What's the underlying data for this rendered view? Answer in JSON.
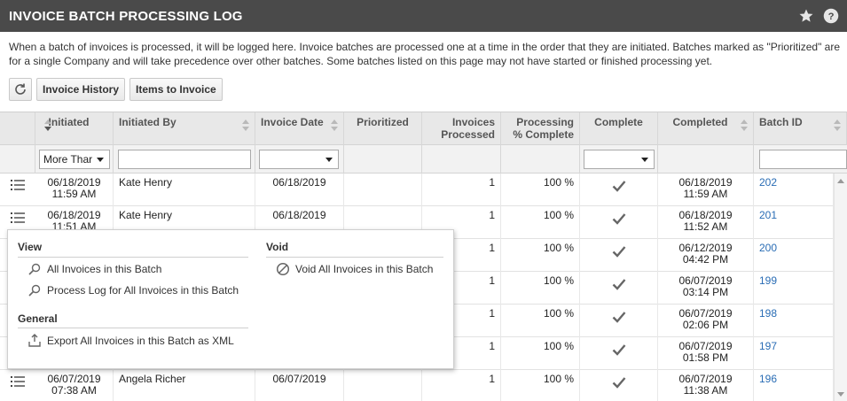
{
  "header": {
    "title": "INVOICE BATCH PROCESSING LOG",
    "star_icon": "star-icon",
    "help_icon": "help-icon"
  },
  "description": "When a batch of invoices is processed, it will be logged here. Invoice batches are processed one at a time in the order that they are initiated. Batches marked as \"Prioritized\" are for a single Company and will take precedence over other batches. Some batches listed on this page may not have started or finished processing yet.",
  "toolbar": {
    "refresh_icon": "refresh-icon",
    "invoice_history": "Invoice History",
    "items_to_invoice": "Items to Invoice"
  },
  "columns": {
    "initiated": "Initiated",
    "initiated_by": "Initiated By",
    "invoice_date": "Invoice Date",
    "prioritized": "Prioritized",
    "invoices_processed": "Invoices Processed",
    "processing_pct": "Processing % Complete",
    "complete": "Complete",
    "completed": "Completed",
    "batch_id": "Batch ID"
  },
  "filters": {
    "initiated_value": "More Thar",
    "invoice_date_value": "",
    "complete_value": "",
    "initiated_by_value": "",
    "batch_id_value": ""
  },
  "rows": [
    {
      "initiated": "06/18/2019\n11:59 AM",
      "initiated_by": "Kate Henry",
      "invoice_date": "06/18/2019",
      "prioritized": "",
      "invoices_processed": "1",
      "processing_pct": "100 %",
      "complete": true,
      "completed": "06/18/2019\n11:59 AM",
      "batch_id": "202"
    },
    {
      "initiated": "06/18/2019\n11:51 AM",
      "initiated_by": "Kate Henry",
      "invoice_date": "06/18/2019",
      "prioritized": "",
      "invoices_processed": "1",
      "processing_pct": "100 %",
      "complete": true,
      "completed": "06/18/2019\n11:52 AM",
      "batch_id": "201"
    },
    {
      "initiated": "",
      "initiated_by": "",
      "invoice_date": "",
      "prioritized": "",
      "invoices_processed": "1",
      "processing_pct": "100 %",
      "complete": true,
      "completed": "06/12/2019\n04:42 PM",
      "batch_id": "200"
    },
    {
      "initiated": "",
      "initiated_by": "",
      "invoice_date": "",
      "prioritized": "",
      "invoices_processed": "1",
      "processing_pct": "100 %",
      "complete": true,
      "completed": "06/07/2019\n03:14 PM",
      "batch_id": "199"
    },
    {
      "initiated": "",
      "initiated_by": "",
      "invoice_date": "",
      "prioritized": "",
      "invoices_processed": "1",
      "processing_pct": "100 %",
      "complete": true,
      "completed": "06/07/2019\n02:06 PM",
      "batch_id": "198"
    },
    {
      "initiated": "",
      "initiated_by": "",
      "invoice_date": "",
      "prioritized": "",
      "invoices_processed": "1",
      "processing_pct": "100 %",
      "complete": true,
      "completed": "06/07/2019\n01:58 PM",
      "batch_id": "197"
    },
    {
      "initiated": "06/07/2019\n07:38 AM",
      "initiated_by": "Angela Richer",
      "invoice_date": "06/07/2019",
      "prioritized": "",
      "invoices_processed": "1",
      "processing_pct": "100 %",
      "complete": true,
      "completed": "06/07/2019\n11:38 AM",
      "batch_id": "196"
    }
  ],
  "context_menu": {
    "view_heading": "View",
    "view_items": [
      "All Invoices in this Batch",
      "Process Log for All Invoices in this Batch"
    ],
    "general_heading": "General",
    "general_items": [
      "Export All Invoices in this Batch as XML"
    ],
    "void_heading": "Void",
    "void_items": [
      "Void All Invoices in this Batch"
    ]
  },
  "colors": {
    "titlebar": "#4a4a4a",
    "link": "#2a6db5",
    "header_bg": "#e8e8e8"
  }
}
